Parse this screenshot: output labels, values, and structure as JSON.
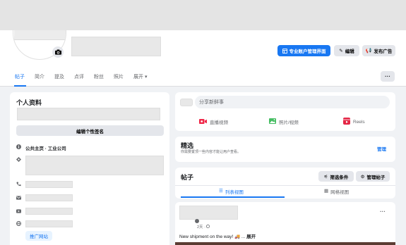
{
  "cover": {},
  "profile": {
    "actions": {
      "pro_dashboard": "专业账户管理界面",
      "edit": "编辑",
      "advertise": "发布广告",
      "more": "···"
    },
    "tabs": [
      "帖子",
      "简介",
      "提及",
      "点评",
      "粉丝",
      "照片",
      "展开 ▾"
    ]
  },
  "intro": {
    "title": "个人资料",
    "edit_bio": "编辑个性签名",
    "page_type": "公共主页 · 工业公司",
    "promote_website": "推广网站"
  },
  "composer": {
    "placeholder": "分享新鲜事",
    "live": "直播视频",
    "photo": "照片/视频",
    "reels": "Reels"
  },
  "featured": {
    "title": "精选",
    "subtitle": "你需要置顶一些内容才能让用户查看。",
    "manage": "管理"
  },
  "posts": {
    "title": "帖子",
    "filter": "筛选条件",
    "manage": "管理帖子",
    "list_view": "列表视图",
    "grid_view": "网格视图"
  },
  "post": {
    "time": "2天 · ",
    "text": "New shipment on the way! 🚚 ...",
    "expand": "展开",
    "more": "···"
  },
  "colors": {
    "accent": "#1877f2",
    "live": "#f02849",
    "photo": "#45bd62",
    "reels": "#e42645"
  }
}
